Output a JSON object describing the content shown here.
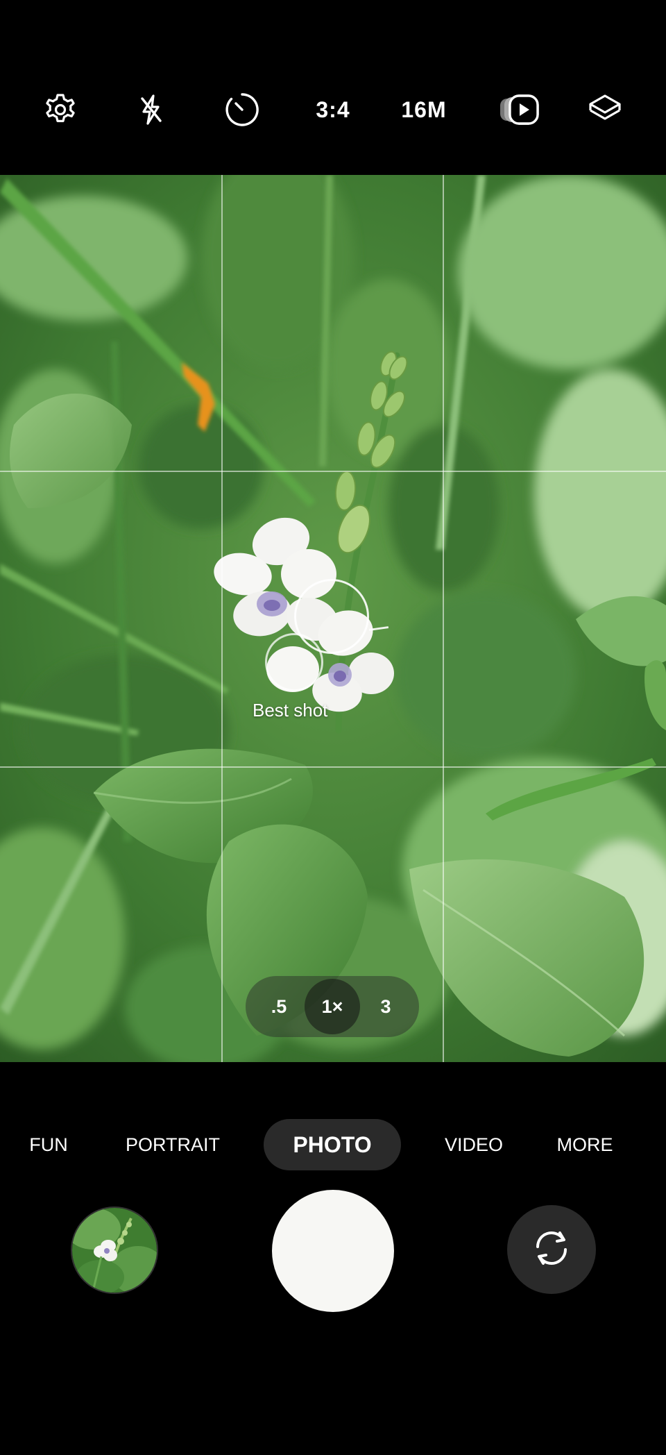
{
  "toolbar": {
    "settings_icon": "gear-icon",
    "flash_icon": "flash-off-icon",
    "timer_icon": "timer-icon",
    "aspect_ratio": "3:4",
    "resolution": "16M",
    "motion_photo_icon": "motion-photo-icon",
    "filters_icon": "layers-icon"
  },
  "viewfinder": {
    "best_shot_label": "Best shot",
    "zoom_options": [
      ".5",
      "1×",
      "3"
    ],
    "active_zoom": "1×"
  },
  "modes": {
    "items": [
      "FUN",
      "PORTRAIT",
      "PHOTO",
      "VIDEO",
      "MORE"
    ],
    "active": "PHOTO"
  },
  "controls": {
    "gallery_icon": "gallery-thumbnail",
    "shutter_icon": "shutter-button",
    "switch_camera_icon": "switch-camera-icon"
  },
  "colors": {
    "background": "#000000",
    "active_mode_pill": "#2a2a2a",
    "shutter": "#f7f7f4"
  }
}
